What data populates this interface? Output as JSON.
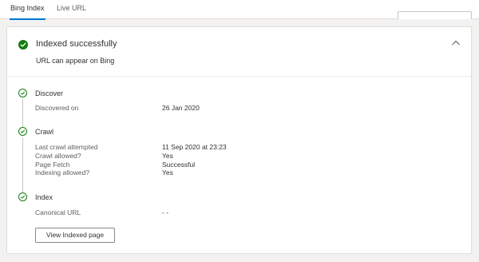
{
  "tabs": [
    {
      "label": "Bing Index",
      "active": true
    },
    {
      "label": "Live URL",
      "active": false
    }
  ],
  "status": {
    "title": "Indexed successfully",
    "subtitle": "URL can appear on Bing",
    "icon": "check-circle-icon",
    "color": "#107c10"
  },
  "steps": {
    "discover": {
      "title": "Discover",
      "rows": [
        {
          "label": "Discovered on",
          "value": "26 Jan 2020"
        }
      ]
    },
    "crawl": {
      "title": "Crawl",
      "rows": [
        {
          "label": "Last crawl attempted",
          "value": "11 Sep 2020 at 23:23"
        },
        {
          "label": "Crawl allowed?",
          "value": "Yes"
        },
        {
          "label": "Page Fetch",
          "value": "Successful"
        },
        {
          "label": "Indexing allowed?",
          "value": "Yes"
        }
      ]
    },
    "index": {
      "title": "Index",
      "rows": [
        {
          "label": "Canonical URL",
          "value": "- -"
        }
      ]
    }
  },
  "actions": {
    "view_indexed_page": "View Indexed page"
  },
  "colors": {
    "accent": "#0078d4",
    "success": "#107c10"
  }
}
